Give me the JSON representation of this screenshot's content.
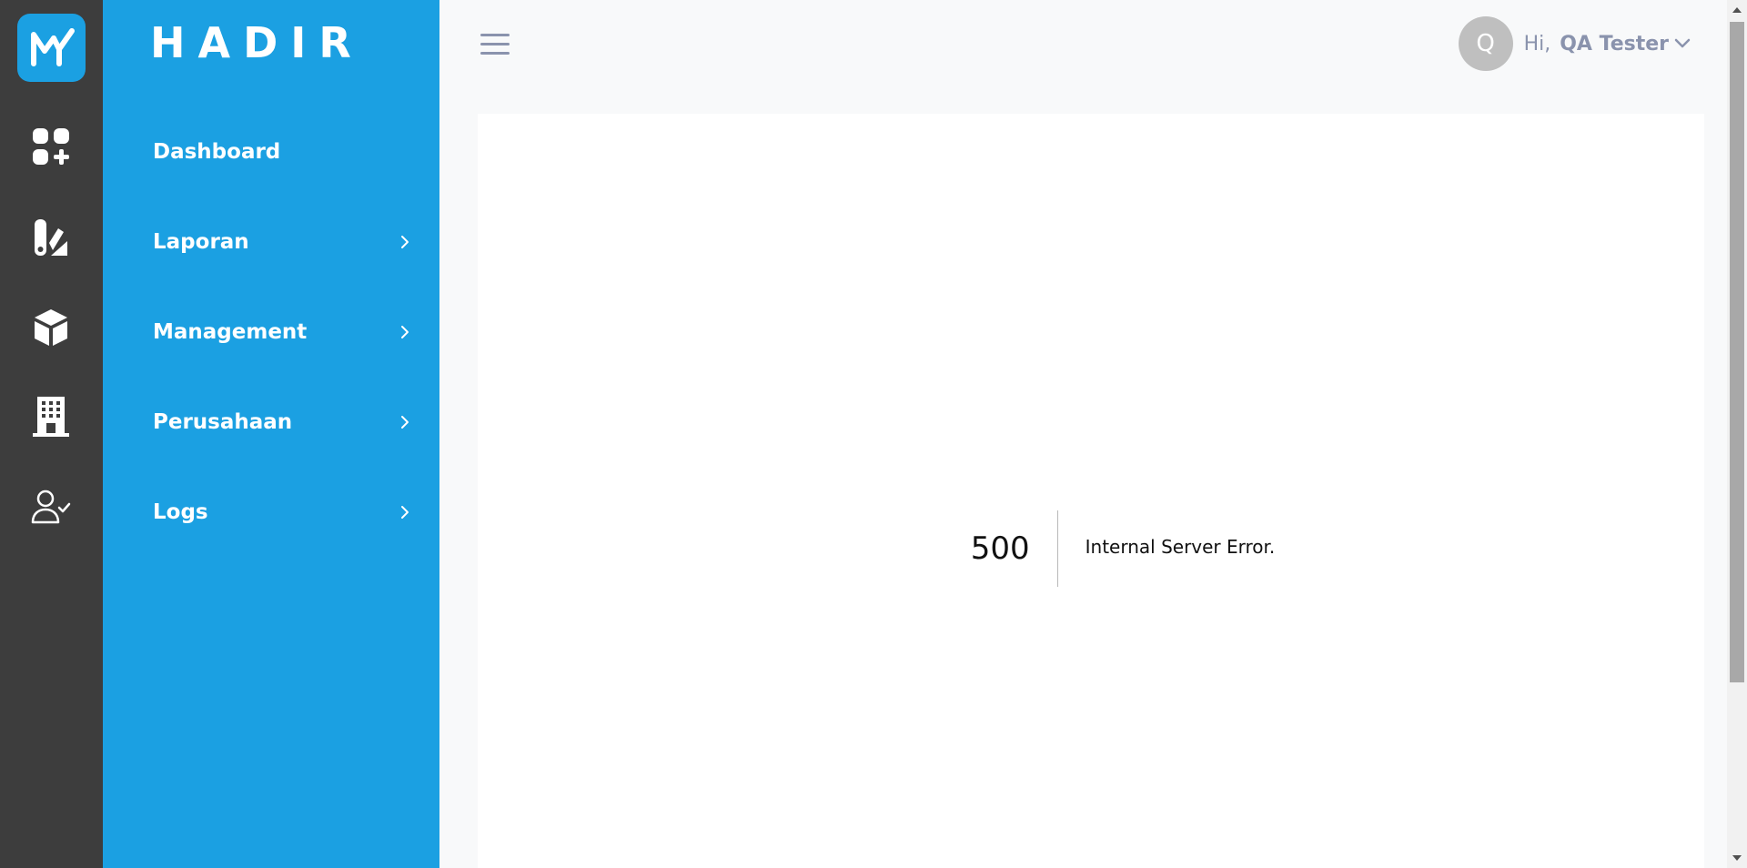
{
  "brand": {
    "name": "HADIR",
    "accent": "#1ba0e2"
  },
  "rail": {
    "icons": [
      "dashboard-add-icon",
      "report-icon",
      "cube-icon",
      "building-icon",
      "user-check-icon"
    ]
  },
  "sidebar": {
    "items": [
      {
        "label": "Dashboard",
        "has_submenu": false
      },
      {
        "label": "Laporan",
        "has_submenu": true
      },
      {
        "label": "Management",
        "has_submenu": true
      },
      {
        "label": "Perusahaan",
        "has_submenu": true
      },
      {
        "label": "Logs",
        "has_submenu": true
      }
    ]
  },
  "header": {
    "avatar_initial": "Q",
    "greeting": "Hi,",
    "user_name": "QA Tester"
  },
  "error": {
    "code": "500",
    "message": "Internal Server Error."
  }
}
